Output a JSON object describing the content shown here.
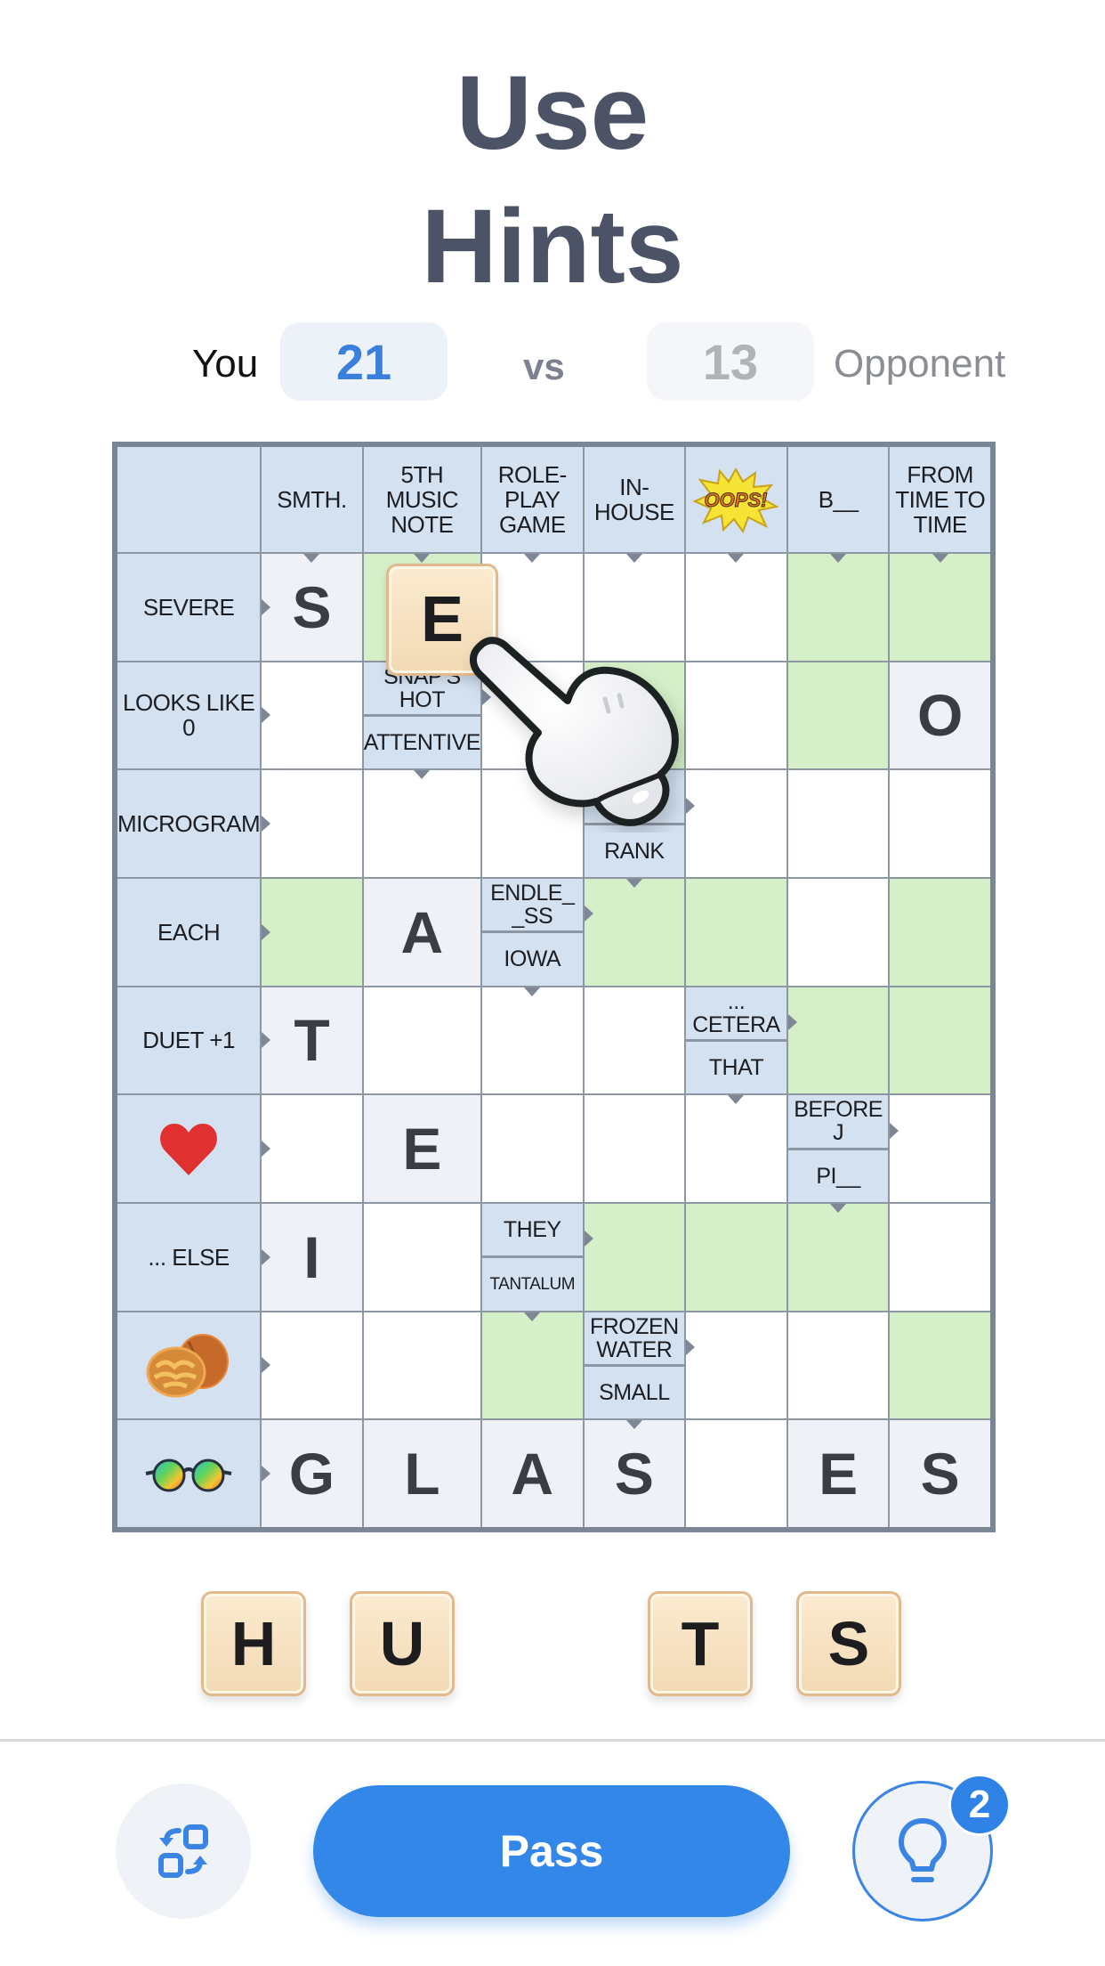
{
  "title": {
    "line1": "Use",
    "line2": "Hints"
  },
  "score": {
    "you_label": "You",
    "you_score": "21",
    "vs_label": "vs",
    "opponent_score": "13",
    "opponent_label": "Opponent"
  },
  "colors": {
    "accent": "#3287e8",
    "clue_cell": "#d3e1f1",
    "green_cell": "#d5f0c9",
    "letter_cell": "#eff1f6",
    "tile": "#f5dfbd"
  },
  "grid": {
    "header_row": [
      {
        "type": "hdr",
        "text": ""
      },
      {
        "type": "hdr",
        "text": "SMTH.",
        "arrow": "down"
      },
      {
        "type": "hdr",
        "text": "5TH MUSIC NOTE",
        "arrow": "down"
      },
      {
        "type": "hdr",
        "text": "ROLE-PLAY GAME",
        "arrow": "down"
      },
      {
        "type": "hdr",
        "text": "IN-HOUSE",
        "arrow": "down"
      },
      {
        "type": "hdr",
        "icon": "oops-icon",
        "arrow": "down"
      },
      {
        "type": "hdr",
        "text": "B__",
        "arrow": "down"
      },
      {
        "type": "hdr",
        "text": "FROM TIME TO TIME",
        "arrow": "down"
      }
    ],
    "rows": [
      [
        {
          "type": "hdr",
          "text": "SEVERE",
          "arrow": "right"
        },
        {
          "type": "letter",
          "text": "S"
        },
        {
          "type": "green"
        },
        {
          "type": "empty"
        },
        {
          "type": "empty"
        },
        {
          "type": "empty"
        },
        {
          "type": "green"
        },
        {
          "type": "green"
        }
      ],
      [
        {
          "type": "hdr",
          "text": "LOOKS LIKE 0",
          "arrow": "right"
        },
        {
          "type": "empty"
        },
        {
          "type": "clue",
          "top": "SNAP'S HOT",
          "bottom": "ATTENTIVE",
          "arrow_top": "right",
          "arrow_bottom": "down"
        },
        {
          "type": "empty"
        },
        {
          "type": "green"
        },
        {
          "type": "empty"
        },
        {
          "type": "green"
        },
        {
          "type": "letter",
          "text": "O"
        }
      ],
      [
        {
          "type": "hdr",
          "text": "MICROGRAM",
          "arrow": "right"
        },
        {
          "type": "empty"
        },
        {
          "type": "empty"
        },
        {
          "type": "empty"
        },
        {
          "type": "clue",
          "top": "_",
          "bottom": "RANK",
          "arrow_top": "right",
          "arrow_bottom": "down"
        },
        {
          "type": "empty"
        },
        {
          "type": "empty"
        },
        {
          "type": "empty"
        }
      ],
      [
        {
          "type": "hdr",
          "text": "EACH",
          "arrow": "right"
        },
        {
          "type": "green"
        },
        {
          "type": "letter",
          "text": "A"
        },
        {
          "type": "clue",
          "top": "ENDLE_ _SS",
          "bottom": "IOWA",
          "arrow_top": "right",
          "arrow_bottom": "down"
        },
        {
          "type": "green"
        },
        {
          "type": "green"
        },
        {
          "type": "empty"
        },
        {
          "type": "green"
        }
      ],
      [
        {
          "type": "hdr",
          "text": "DUET +1",
          "arrow": "right"
        },
        {
          "type": "letter",
          "text": "T"
        },
        {
          "type": "empty"
        },
        {
          "type": "empty"
        },
        {
          "type": "empty"
        },
        {
          "type": "clue",
          "top": "... CETERA",
          "bottom": "THAT",
          "arrow_top": "right",
          "arrow_bottom": "down"
        },
        {
          "type": "green"
        },
        {
          "type": "green"
        }
      ],
      [
        {
          "type": "hdr",
          "icon": "heart-icon",
          "arrow": "right"
        },
        {
          "type": "empty"
        },
        {
          "type": "letter",
          "text": "E"
        },
        {
          "type": "empty"
        },
        {
          "type": "empty"
        },
        {
          "type": "empty"
        },
        {
          "type": "clue",
          "top": "BEFORE J",
          "bottom": "PI__",
          "arrow_top": "right",
          "arrow_bottom": "down"
        },
        {
          "type": "empty"
        }
      ],
      [
        {
          "type": "hdr",
          "text": "... ELSE",
          "arrow": "right"
        },
        {
          "type": "letter",
          "text": "I"
        },
        {
          "type": "empty"
        },
        {
          "type": "clue",
          "top": "THEY",
          "bottom": "TANTALUM",
          "small_bottom": true,
          "arrow_top": "right",
          "arrow_bottom": "down"
        },
        {
          "type": "green"
        },
        {
          "type": "green"
        },
        {
          "type": "green"
        },
        {
          "type": "empty"
        }
      ],
      [
        {
          "type": "hdr",
          "icon": "walnut-icon",
          "arrow": "right"
        },
        {
          "type": "empty"
        },
        {
          "type": "empty"
        },
        {
          "type": "green"
        },
        {
          "type": "clue",
          "top": "FROZEN WATER",
          "bottom": "SMALL",
          "arrow_top": "right",
          "arrow_bottom": "down"
        },
        {
          "type": "empty"
        },
        {
          "type": "empty"
        },
        {
          "type": "green"
        }
      ],
      [
        {
          "type": "hdr",
          "icon": "sunglasses-icon",
          "arrow": "right"
        },
        {
          "type": "letter",
          "text": "G"
        },
        {
          "type": "letter",
          "text": "L"
        },
        {
          "type": "letter",
          "text": "A"
        },
        {
          "type": "letter",
          "text": "S"
        },
        {
          "type": "empty"
        },
        {
          "type": "letter",
          "text": "E"
        },
        {
          "type": "letter",
          "text": "S"
        }
      ]
    ]
  },
  "dragging_tile": "E",
  "rack": [
    {
      "letter": "H",
      "slot": 0
    },
    {
      "letter": "U",
      "slot": 1
    },
    {
      "letter": "T",
      "slot": 3
    },
    {
      "letter": "S",
      "slot": 4
    }
  ],
  "actions": {
    "swap_icon": "swap-tiles-icon",
    "pass_label": "Pass",
    "hint_icon": "lightbulb-icon",
    "hint_count": "2"
  }
}
